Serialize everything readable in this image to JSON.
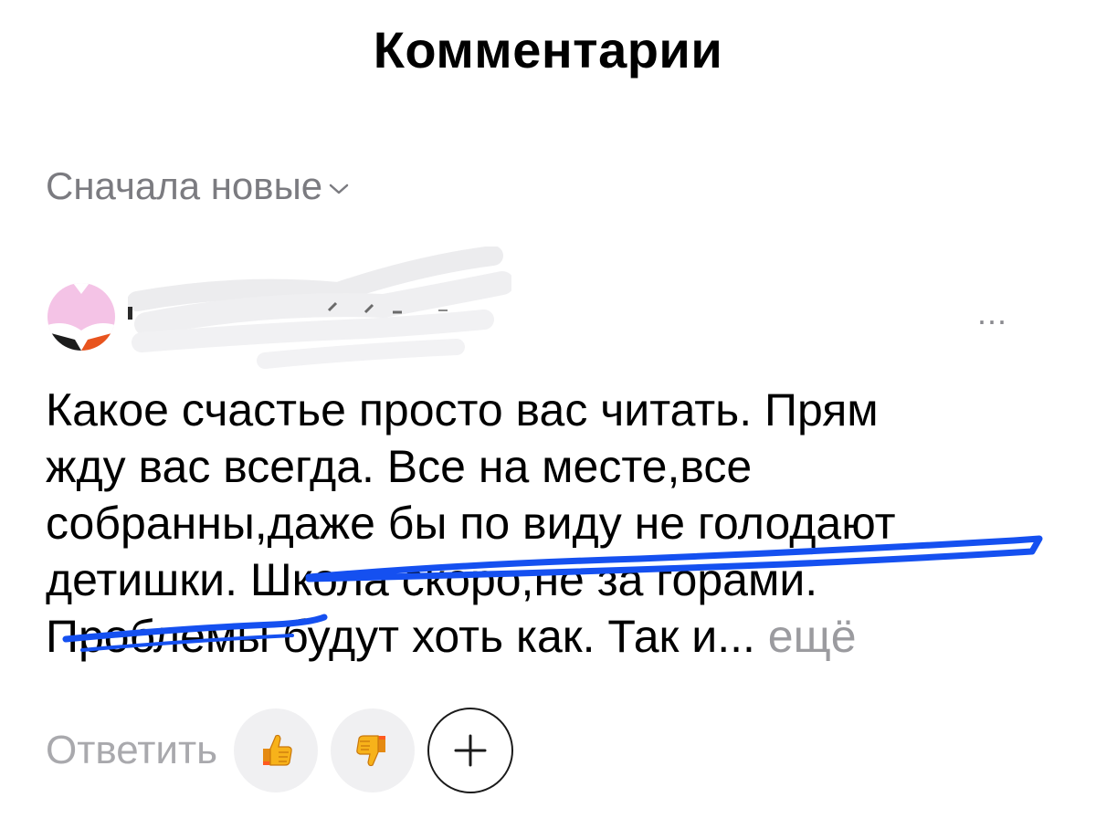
{
  "header": {
    "title": "Комментарии"
  },
  "sort": {
    "label": "Сначала новые",
    "icon": "chevron-down-icon"
  },
  "comment": {
    "author_hidden": true,
    "more_menu_label": "...",
    "text_lines": [
      "Какое счастье просто вас читать. Прям",
      "жду вас всегда. Все на месте,все",
      "собранны,даже бы по виду не голодают",
      "детишки. Школа скоро,не за горами.",
      "Проблемы будут хоть как. Так и..."
    ],
    "expand_label": "ещё",
    "underline_color": "#1550f0"
  },
  "actions": {
    "reply_label": "Ответить",
    "like_icon": "thumbs-up-icon",
    "dislike_icon": "thumbs-down-icon",
    "add_icon": "plus-icon"
  }
}
